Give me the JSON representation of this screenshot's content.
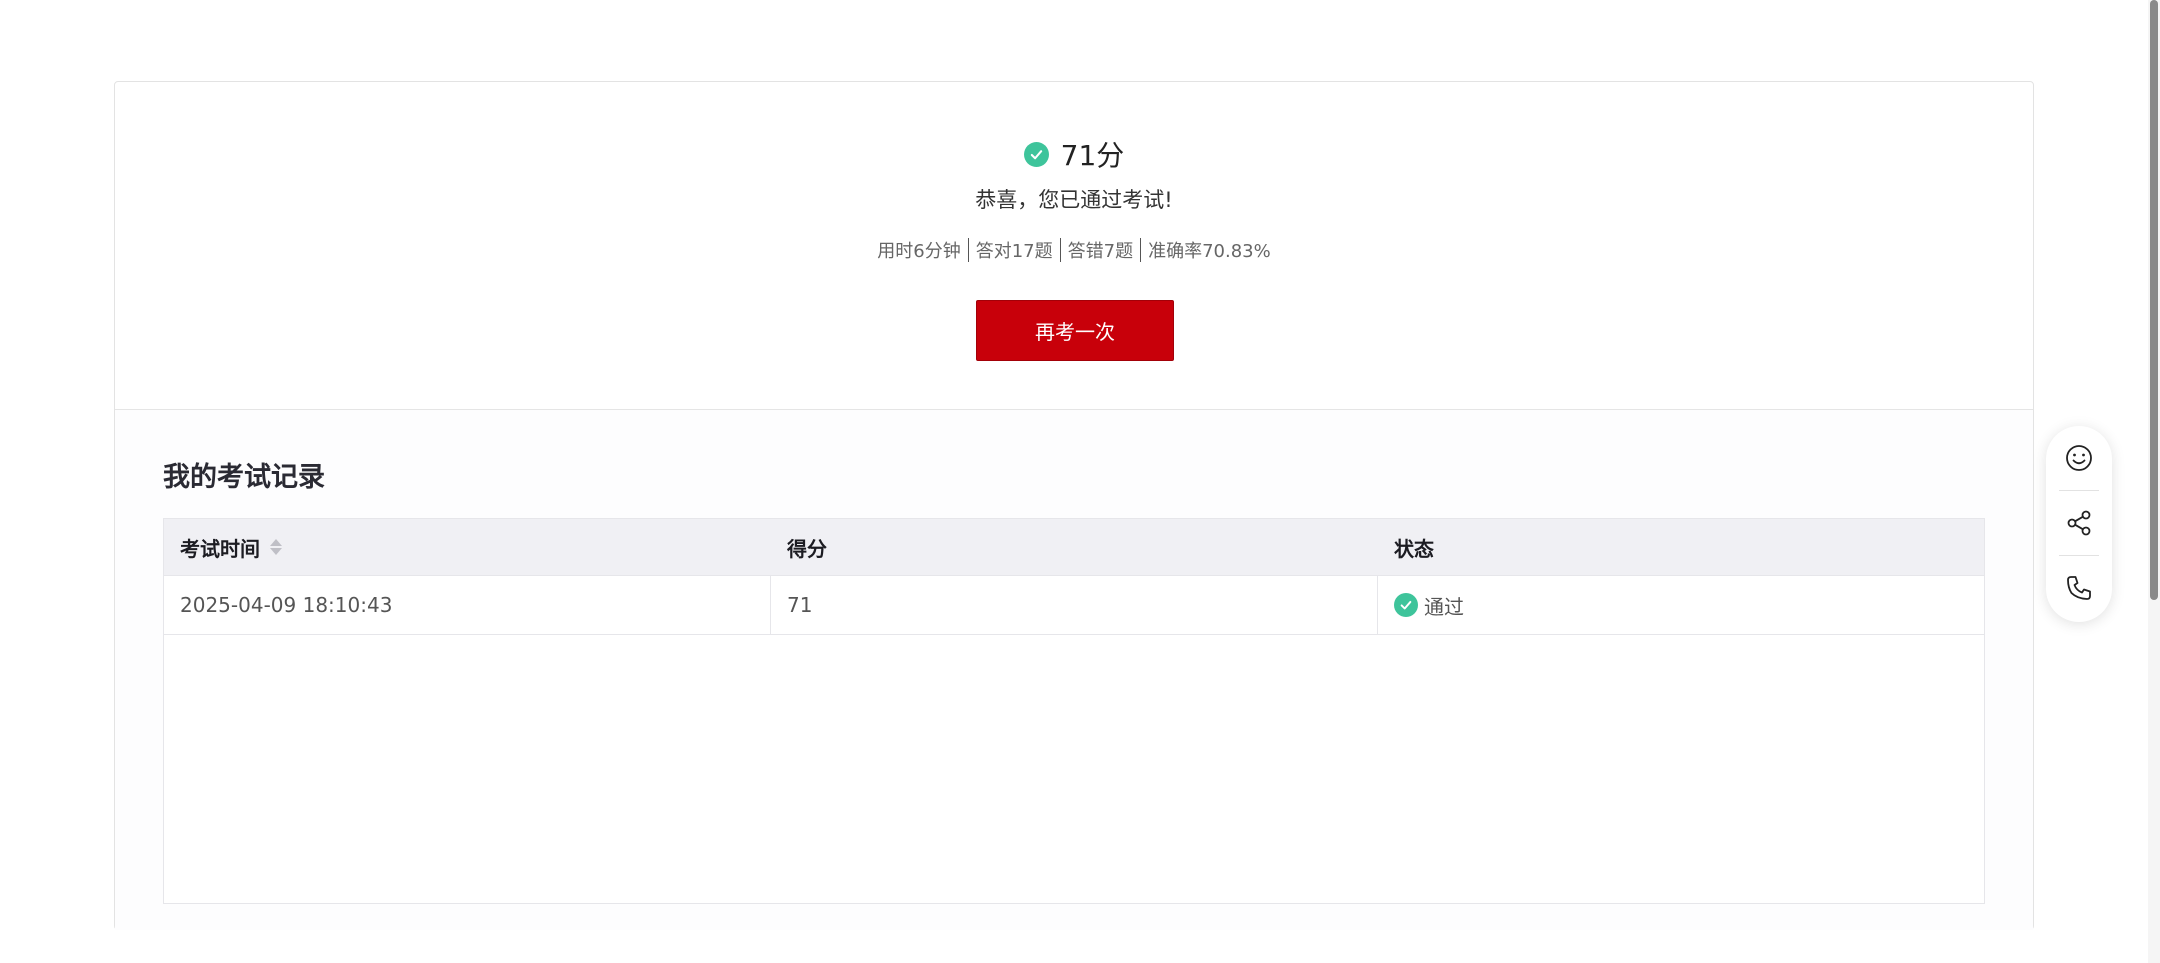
{
  "result": {
    "score": "71分",
    "congrats": "恭喜，您已通过考试!",
    "stats": [
      "用时6分钟",
      "答对17题",
      "答错7题",
      "准确率70.83%"
    ],
    "retry_label": "再考一次"
  },
  "records": {
    "title": "我的考试记录",
    "columns": [
      "考试时间",
      "得分",
      "状态"
    ],
    "rows": [
      {
        "time": "2025-04-09 18:10:43",
        "score": "71",
        "status": "通过"
      }
    ]
  },
  "float_bar": {
    "icons": [
      "smile-icon",
      "share-icon",
      "phone-icon"
    ]
  },
  "colors": {
    "accent": "#c8000a",
    "success": "#3ec49b"
  }
}
